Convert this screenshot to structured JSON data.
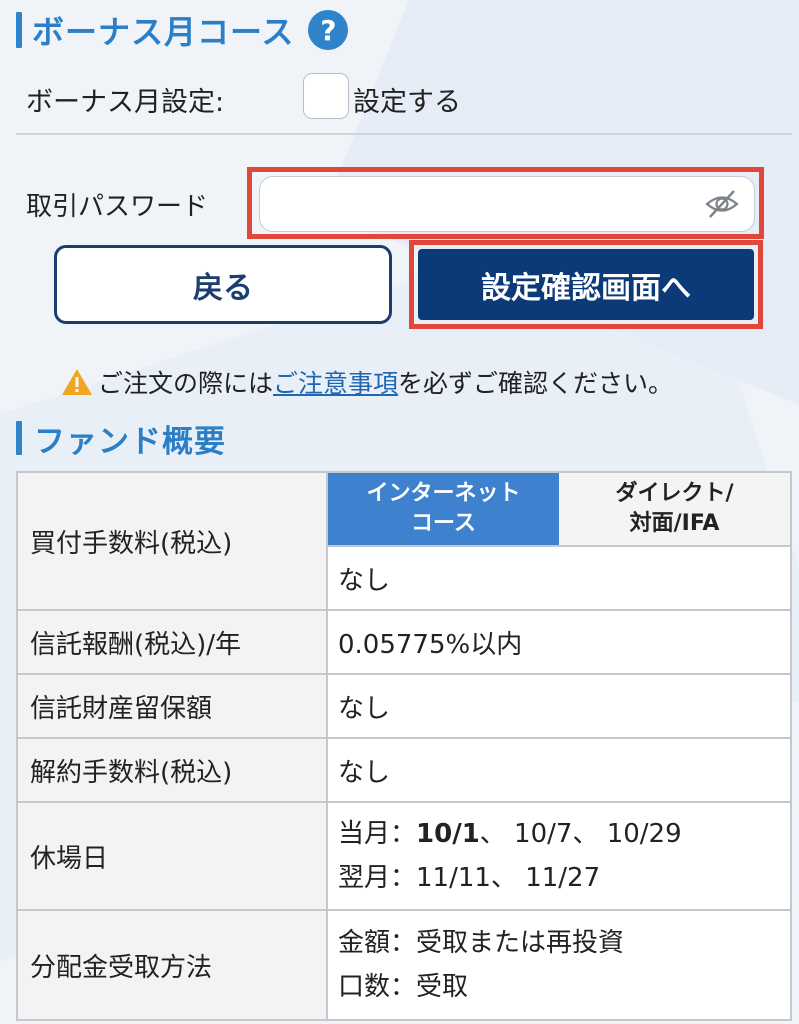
{
  "bonus_section": {
    "title": "ボーナス月コース",
    "help_icon": "?",
    "setting_label": "ボーナス月設定:",
    "checkbox_label": "設定する",
    "checkbox_checked": false
  },
  "password": {
    "label": "取引パスワード",
    "value": "",
    "placeholder": ""
  },
  "buttons": {
    "back": "戻る",
    "confirm": "設定確認画面へ"
  },
  "notice": {
    "before": "ご注文の際には",
    "link": "ご注意事項",
    "after": "を必ずご確認ください。"
  },
  "fund_section": {
    "title": "ファンド概要"
  },
  "fund_table": {
    "purchase_fee": {
      "label": "買付手数料(税込)",
      "tab_internet": "インターネット\nコース",
      "tab_direct": "ダイレクト/\n対面/IFA",
      "value": "なし"
    },
    "trust_fee": {
      "label": "信託報酬(税込)/年",
      "value": "0.05775%以内"
    },
    "retention": {
      "label": "信託財産留保額",
      "value": "なし"
    },
    "cancel_fee": {
      "label": "解約手数料(税込)",
      "value": "なし"
    },
    "holidays": {
      "label": "休場日",
      "this_month_prefix": "当月：",
      "this_month_bold": "10/1",
      "this_month_rest": "、 10/7、 10/29",
      "next_month": "翌月：11/11、 11/27"
    },
    "distribution": {
      "label": "分配金受取方法",
      "line1": "金額：受取または再投資",
      "line2": "口数：受取"
    }
  },
  "colors": {
    "accent": "#2e83c9",
    "primary_button": "#0c3a78",
    "highlight": "#e0463a",
    "tab_active": "#3e82cf"
  }
}
